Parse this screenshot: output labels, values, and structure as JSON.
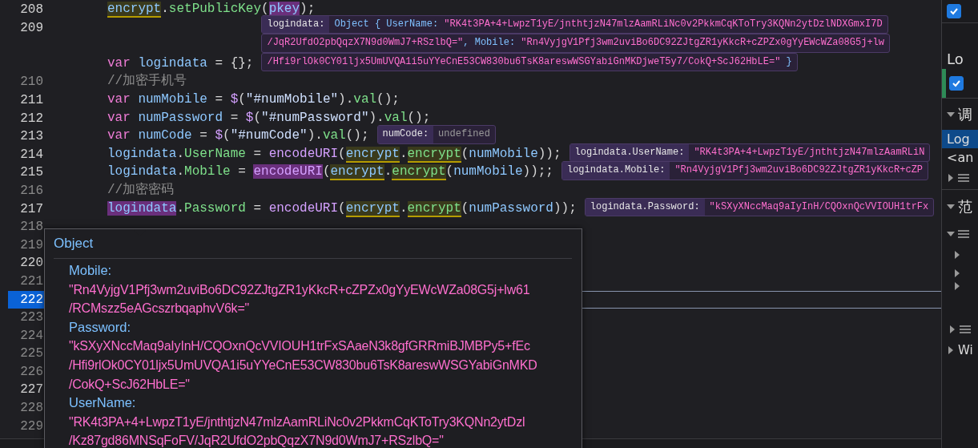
{
  "editor": {
    "lines": [
      {
        "number": "208",
        "breakable": true,
        "current": false,
        "tokens": [
          {
            "text": "encrypt",
            "kind": "ident",
            "highlighted": false,
            "referenced": true
          },
          {
            "text": ".",
            "kind": "punct",
            "highlighted": false,
            "referenced": false
          },
          {
            "text": "setPublicKey",
            "kind": "fn",
            "highlighted": false,
            "referenced": false
          },
          {
            "text": "(",
            "kind": "punct",
            "highlighted": false,
            "referenced": false
          },
          {
            "text": "pkey",
            "kind": "ident",
            "highlighted": true,
            "referenced": false
          },
          {
            "text": ");",
            "kind": "punct",
            "highlighted": false,
            "referenced": false
          }
        ]
      },
      {
        "number": "209",
        "breakable": true,
        "current": false,
        "tokens": [
          {
            "text": "var",
            "kind": "kw",
            "highlighted": false,
            "referenced": false
          },
          {
            "text": " logindata ",
            "kind": "ident",
            "highlighted": false,
            "referenced": false
          },
          {
            "text": "= {};",
            "kind": "punct",
            "highlighted": false,
            "referenced": false
          }
        ],
        "inline": {
          "label": "logindata:",
          "rows": [
            [
              {
                "text": "Object { UserName: ",
                "kind": "key"
              },
              {
                "text": "\"RK4t3PA+4+LwpzT1yE/jnthtjzN47mlzAamRLiNc0v2PkkmCqKToTry3KQNn2ytDzlNDXGmxI7D",
                "kind": "str"
              }
            ],
            [
              {
                "text": "/JqR2UfdO2pbQqzX7N9d0WmJ7+RSzlbQ=\"",
                "kind": "str"
              },
              {
                "text": ", Mobile: ",
                "kind": "key"
              },
              {
                "text": "\"Rn4VyjgV1Pfj3wm2uviBo6DC92ZJtgZR1yKkcR+cZPZx0gYyEWcWZa08G5j+lw",
                "kind": "str"
              }
            ],
            [
              {
                "text": "/Hfi9rlOk0CY01ljx5UmUVQA1i5uYYeCnE53CW830bu6TsK8areswWSGYabiGnMKDjweT5y7/CokQ+ScJ62HbLE=\"",
                "kind": "str"
              },
              {
                "text": " }",
                "kind": "key"
              }
            ]
          ]
        }
      },
      {
        "number": "210",
        "breakable": false,
        "current": false,
        "tokens": [
          {
            "text": "//加密手机号",
            "kind": "comment",
            "highlighted": false,
            "referenced": false
          }
        ]
      },
      {
        "number": "211",
        "breakable": true,
        "current": false,
        "tokens": [
          {
            "text": "var",
            "kind": "kw",
            "highlighted": false,
            "referenced": false
          },
          {
            "text": " numMobile ",
            "kind": "ident",
            "highlighted": false,
            "referenced": false
          },
          {
            "text": "= ",
            "kind": "punct",
            "highlighted": false,
            "referenced": false
          },
          {
            "text": "$",
            "kind": "builtin",
            "highlighted": false,
            "referenced": false
          },
          {
            "text": "(",
            "kind": "punct",
            "highlighted": false,
            "referenced": false
          },
          {
            "text": "\"#numMobile\"",
            "kind": "str",
            "highlighted": false,
            "referenced": false
          },
          {
            "text": ").",
            "kind": "punct",
            "highlighted": false,
            "referenced": false
          },
          {
            "text": "val",
            "kind": "fn",
            "highlighted": false,
            "referenced": false
          },
          {
            "text": "();",
            "kind": "punct",
            "highlighted": false,
            "referenced": false
          }
        ]
      },
      {
        "number": "212",
        "breakable": true,
        "current": false,
        "tokens": [
          {
            "text": "var",
            "kind": "kw",
            "highlighted": false,
            "referenced": false
          },
          {
            "text": " numPassword ",
            "kind": "ident",
            "highlighted": false,
            "referenced": false
          },
          {
            "text": "= ",
            "kind": "punct",
            "highlighted": false,
            "referenced": false
          },
          {
            "text": "$",
            "kind": "builtin",
            "highlighted": false,
            "referenced": false
          },
          {
            "text": "(",
            "kind": "punct",
            "highlighted": false,
            "referenced": false
          },
          {
            "text": "\"#numPassword\"",
            "kind": "str",
            "highlighted": false,
            "referenced": false
          },
          {
            "text": ").",
            "kind": "punct",
            "highlighted": false,
            "referenced": false
          },
          {
            "text": "val",
            "kind": "fn",
            "highlighted": false,
            "referenced": false
          },
          {
            "text": "();",
            "kind": "punct",
            "highlighted": false,
            "referenced": false
          }
        ]
      },
      {
        "number": "213",
        "breakable": true,
        "current": false,
        "tokens": [
          {
            "text": "var",
            "kind": "kw",
            "highlighted": false,
            "referenced": false
          },
          {
            "text": " numCode ",
            "kind": "ident",
            "highlighted": false,
            "referenced": false
          },
          {
            "text": "= ",
            "kind": "punct",
            "highlighted": false,
            "referenced": false
          },
          {
            "text": "$",
            "kind": "builtin",
            "highlighted": false,
            "referenced": false
          },
          {
            "text": "(",
            "kind": "punct",
            "highlighted": false,
            "referenced": false
          },
          {
            "text": "\"#numCode\"",
            "kind": "str",
            "highlighted": false,
            "referenced": false
          },
          {
            "text": ").",
            "kind": "punct",
            "highlighted": false,
            "referenced": false
          },
          {
            "text": "val",
            "kind": "fn",
            "highlighted": false,
            "referenced": false
          },
          {
            "text": "();",
            "kind": "punct",
            "highlighted": false,
            "referenced": false
          }
        ],
        "inline": {
          "label": "numCode:",
          "rows": [
            [
              {
                "text": "undefined",
                "kind": "undef"
              }
            ]
          ]
        }
      },
      {
        "number": "214",
        "breakable": true,
        "current": false,
        "tokens": [
          {
            "text": "logindata",
            "kind": "ident",
            "highlighted": false,
            "referenced": false
          },
          {
            "text": ".",
            "kind": "punct",
            "highlighted": false,
            "referenced": false
          },
          {
            "text": "UserName",
            "kind": "fn",
            "highlighted": false,
            "referenced": false
          },
          {
            "text": " = ",
            "kind": "punct",
            "highlighted": false,
            "referenced": false
          },
          {
            "text": "encodeURI",
            "kind": "builtin",
            "highlighted": false,
            "referenced": false
          },
          {
            "text": "(",
            "kind": "punct",
            "highlighted": false,
            "referenced": false
          },
          {
            "text": "encrypt",
            "kind": "ident",
            "highlighted": false,
            "referenced": true
          },
          {
            "text": ".",
            "kind": "punct",
            "highlighted": false,
            "referenced": false
          },
          {
            "text": "encrypt",
            "kind": "fn",
            "highlighted": false,
            "referenced": true
          },
          {
            "text": "(",
            "kind": "punct",
            "highlighted": false,
            "referenced": false
          },
          {
            "text": "numMobile",
            "kind": "ident",
            "highlighted": false,
            "referenced": false
          },
          {
            "text": "));",
            "kind": "punct",
            "highlighted": false,
            "referenced": false
          }
        ],
        "inline": {
          "label": "logindata.UserName:",
          "rows": [
            [
              {
                "text": "\"RK4t3PA+4+LwpzT1yE/jnthtjzN47mlzAamRLiN",
                "kind": "str"
              }
            ]
          ]
        }
      },
      {
        "number": "215",
        "breakable": true,
        "current": false,
        "tokens": [
          {
            "text": "logindata",
            "kind": "ident",
            "highlighted": false,
            "referenced": false
          },
          {
            "text": ".",
            "kind": "punct",
            "highlighted": false,
            "referenced": false
          },
          {
            "text": "Mobile",
            "kind": "fn",
            "highlighted": false,
            "referenced": false
          },
          {
            "text": " = ",
            "kind": "punct",
            "highlighted": false,
            "referenced": false
          },
          {
            "text": "encodeURI",
            "kind": "builtin",
            "highlighted": true,
            "referenced": false
          },
          {
            "text": "(",
            "kind": "punct",
            "highlighted": false,
            "referenced": false
          },
          {
            "text": "encrypt",
            "kind": "ident",
            "highlighted": false,
            "referenced": true
          },
          {
            "text": ".",
            "kind": "punct",
            "highlighted": false,
            "referenced": false
          },
          {
            "text": "encrypt",
            "kind": "fn",
            "highlighted": false,
            "referenced": true
          },
          {
            "text": "(",
            "kind": "punct",
            "highlighted": false,
            "referenced": false
          },
          {
            "text": "numMobile",
            "kind": "ident",
            "highlighted": false,
            "referenced": false
          },
          {
            "text": "));;",
            "kind": "punct",
            "highlighted": false,
            "referenced": false
          }
        ],
        "inline": {
          "label": "logindata.Mobile:",
          "rows": [
            [
              {
                "text": "\"Rn4VyjgV1Pfj3wm2uviBo6DC92ZJtgZR1yKkcR+cZP",
                "kind": "str"
              }
            ]
          ]
        }
      },
      {
        "number": "216",
        "breakable": false,
        "current": false,
        "tokens": [
          {
            "text": "//加密密码",
            "kind": "comment",
            "highlighted": false,
            "referenced": false
          }
        ]
      },
      {
        "number": "217",
        "breakable": true,
        "current": false,
        "tokens": [
          {
            "text": "logindata",
            "kind": "ident",
            "highlighted": true,
            "referenced": false
          },
          {
            "text": ".",
            "kind": "punct",
            "highlighted": false,
            "referenced": false
          },
          {
            "text": "Password",
            "kind": "fn",
            "highlighted": false,
            "referenced": false
          },
          {
            "text": " = ",
            "kind": "punct",
            "highlighted": false,
            "referenced": false
          },
          {
            "text": "encodeURI",
            "kind": "builtin",
            "highlighted": false,
            "referenced": false
          },
          {
            "text": "(",
            "kind": "punct",
            "highlighted": false,
            "referenced": false
          },
          {
            "text": "encrypt",
            "kind": "ident",
            "highlighted": false,
            "referenced": true
          },
          {
            "text": ".",
            "kind": "punct",
            "highlighted": false,
            "referenced": false
          },
          {
            "text": "encrypt",
            "kind": "fn",
            "highlighted": false,
            "referenced": true
          },
          {
            "text": "(",
            "kind": "punct",
            "highlighted": false,
            "referenced": false
          },
          {
            "text": "numPassword",
            "kind": "ident",
            "highlighted": false,
            "referenced": false
          },
          {
            "text": "));",
            "kind": "punct",
            "highlighted": false,
            "referenced": false
          }
        ],
        "inline": {
          "label": "logindata.Password:",
          "rows": [
            [
              {
                "text": "\"kSXyXNccMaq9aIyInH/CQOxnQcVVIOUH1trFx",
                "kind": "str"
              }
            ]
          ]
        }
      },
      {
        "number": "218",
        "breakable": false,
        "current": false
      },
      {
        "number": "219",
        "breakable": false,
        "current": false
      },
      {
        "number": "220",
        "breakable": true,
        "current": false
      },
      {
        "number": "221",
        "breakable": false,
        "current": false
      },
      {
        "number": "222",
        "breakable": true,
        "current": true
      },
      {
        "number": "223",
        "breakable": false,
        "current": false
      },
      {
        "number": "224",
        "breakable": false,
        "current": false
      },
      {
        "number": "225",
        "breakable": false,
        "current": false
      },
      {
        "number": "226",
        "breakable": false,
        "current": false
      },
      {
        "number": "227",
        "breakable": true,
        "current": false
      },
      {
        "number": "228",
        "breakable": false,
        "current": false
      },
      {
        "number": "229",
        "breakable": false,
        "current": false
      }
    ]
  },
  "popup": {
    "title": "Object",
    "entries": [
      {
        "key": "Mobile:",
        "lines": [
          "\"Rn4VyjgV1Pfj3wm2uviBo6DC92ZJtgZR1yKkcR+cZPZx0gYyEWcWZa08G5j+lw61",
          "/RCMszz5eAGcszrbqaphvV6k=\""
        ]
      },
      {
        "key": "Password:",
        "lines": [
          "\"kSXyXNccMaq9aIyInH/CQOxnQcVVIOUH1trFxSAaeN3k8gfGRRmiBJMBPy5+fEc",
          "/Hfi9rlOk0CY01ljx5UmUVQA1i5uYYeCnE53CW830bu6TsK8areswWSGYabiGnMKD",
          "/CokQ+ScJ62HbLE=\""
        ]
      },
      {
        "key": "UserName:",
        "lines": [
          "\"RK4t3PA+4+LwpzT1yE/jnthtjzN47mlzAamRLiNc0v2PkkmCqKToTry3KQNn2ytDzl",
          "/Kz87gd86MNSqFoFV/JqR2UfdO2pbQqzX7N9d0WmJ7+RSzlbQ=\""
        ]
      }
    ]
  },
  "sidebar": {
    "items": [
      {
        "kind": "checkbox",
        "checked": true
      },
      {
        "kind": "text",
        "label": "Lo"
      },
      {
        "kind": "checkbox",
        "checked": true
      },
      {
        "kind": "section",
        "label": "调",
        "expanded": true
      },
      {
        "kind": "row",
        "label": "Log",
        "selected": true
      },
      {
        "kind": "row",
        "label": "<an",
        "selected": false
      },
      {
        "kind": "node",
        "expanded": false
      },
      {
        "kind": "section",
        "label": "范",
        "expanded": true
      },
      {
        "kind": "node",
        "expanded": true
      },
      {
        "kind": "leaf",
        "expanded": false
      },
      {
        "kind": "leaf",
        "expanded": false
      },
      {
        "kind": "leaf",
        "expanded": false
      },
      {
        "kind": "node",
        "expanded": false
      },
      {
        "kind": "tree",
        "label": "Wi",
        "expanded": false
      }
    ]
  }
}
